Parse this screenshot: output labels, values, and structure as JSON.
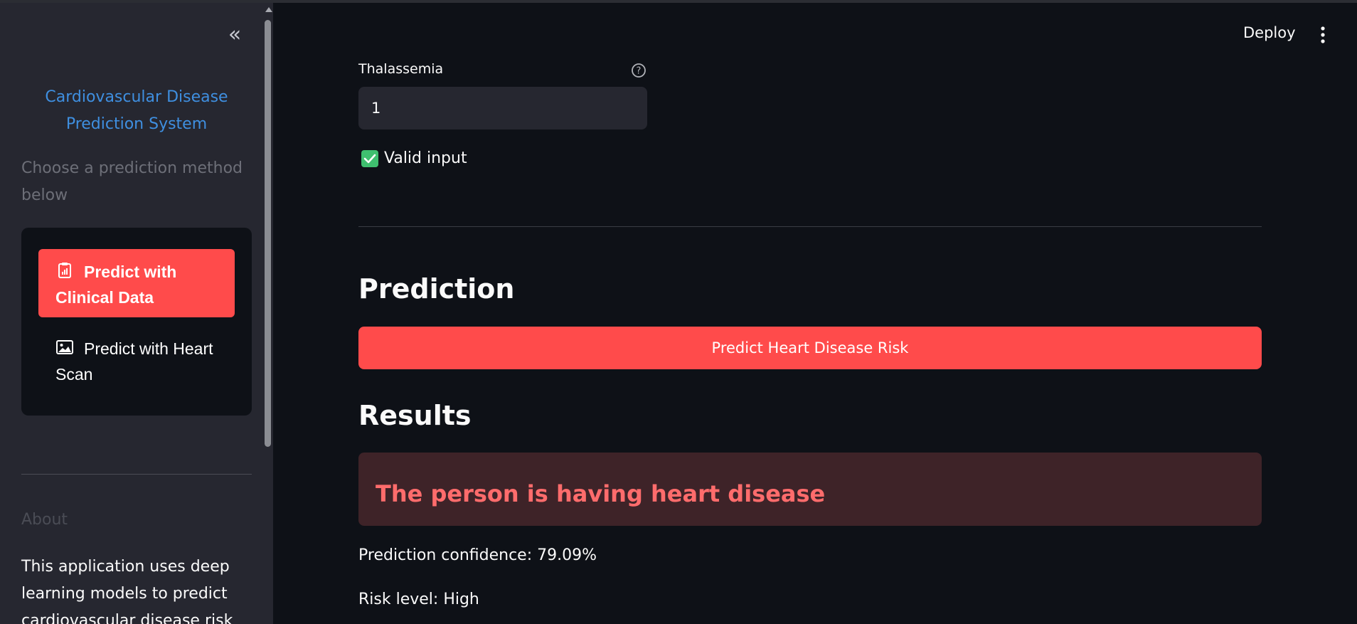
{
  "sidebar": {
    "collapse_glyph": "«",
    "title": "Cardiovascular Disease Prediction System",
    "subtitle": "Choose a prediction method below",
    "menu": [
      {
        "label": "Predict with Clinical Data",
        "icon": "clipboard-chart-icon",
        "active": true
      },
      {
        "label": "Predict with Heart Scan",
        "icon": "image-icon",
        "active": false
      }
    ],
    "about_heading": "About",
    "about_text": "This application uses deep learning models to predict cardiovascular disease risk"
  },
  "header": {
    "deploy_label": "Deploy",
    "menu_icon": "kebab-menu-icon"
  },
  "main": {
    "field_label": "Thalassemia",
    "field_value": "1",
    "validation_text": "Valid input",
    "prediction_heading": "Prediction",
    "predict_button_label": "Predict Heart Disease Risk",
    "results_heading": "Results",
    "result_message": "The person is having heart disease",
    "confidence_text": "Prediction confidence: 79.09%",
    "risk_text": "Risk level: High"
  },
  "colors": {
    "background": "#0e1117",
    "sidebar": "#262730",
    "accent": "#ff4b4b",
    "title_blue": "#3f8fe0",
    "success_green": "#3fbf6f",
    "error_bg": "#3e2328",
    "error_text": "#ff6c6c"
  }
}
